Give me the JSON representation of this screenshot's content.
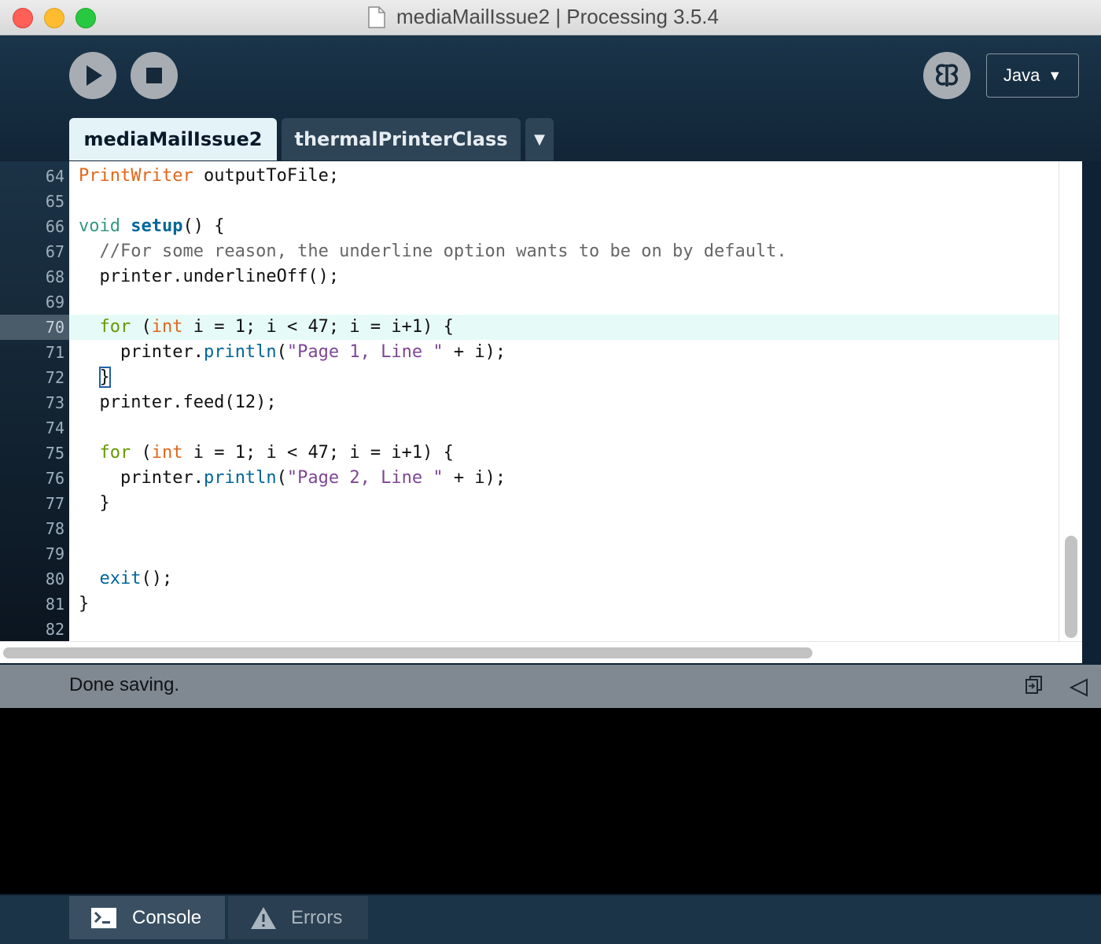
{
  "window": {
    "title": "mediaMailIssue2 | Processing 3.5.4"
  },
  "toolbar": {
    "mode_label": "Java",
    "mode_arrow": "▼"
  },
  "tabs": [
    {
      "label": "mediaMailIssue2",
      "active": true
    },
    {
      "label": "thermalPrinterClass",
      "active": false
    }
  ],
  "tab_menu_glyph": "▼",
  "editor": {
    "current_line": "70",
    "lines": [
      {
        "num": "64"
      },
      {
        "num": "65"
      },
      {
        "num": "66"
      },
      {
        "num": "67"
      },
      {
        "num": "68"
      },
      {
        "num": "69"
      },
      {
        "num": "70"
      },
      {
        "num": "71"
      },
      {
        "num": "72"
      },
      {
        "num": "73"
      },
      {
        "num": "74"
      },
      {
        "num": "75"
      },
      {
        "num": "76"
      },
      {
        "num": "77"
      },
      {
        "num": "78"
      },
      {
        "num": "79"
      },
      {
        "num": "80"
      },
      {
        "num": "81"
      },
      {
        "num": "82"
      }
    ],
    "tokens": {
      "l64_type": "PrintWriter",
      "l64_rest": " outputToFile;",
      "l66_void": "void",
      "l66_sp": " ",
      "l66_setup": "setup",
      "l66_rest": "() {",
      "l67_comment": "  //For some reason, the underline option wants to be on by default.",
      "l68": "  printer.underlineOff();",
      "l70_indent": "  ",
      "l70_for": "for",
      "l70_a": " (",
      "l70_int": "int",
      "l70_b": " i = 1; i < 47; i = i+1) {",
      "l71_a": "    printer.",
      "l71_println": "println",
      "l71_b": "(",
      "l71_str": "\"Page 1, Line \"",
      "l71_c": " + i);",
      "l72_indent": "  ",
      "l72_brace": "}",
      "l73": "  printer.feed(12);",
      "l75_indent": "  ",
      "l75_for": "for",
      "l75_a": " (",
      "l75_int": "int",
      "l75_b": " i = 1; i < 47; i = i+1) {",
      "l76_a": "    printer.",
      "l76_println": "println",
      "l76_b": "(",
      "l76_str": "\"Page 2, Line \"",
      "l76_c": " + i);",
      "l77": "  }",
      "l80_indent": "  ",
      "l80_exit": "exit",
      "l80_rest": "();",
      "l81": "}"
    }
  },
  "status": {
    "message": "Done saving."
  },
  "bottom_tabs": {
    "console_label": "Console",
    "errors_label": "Errors"
  },
  "icons": {
    "run": "play-icon",
    "stop": "stop-icon",
    "debug": "butterfly-icon",
    "copy": "copy-icon",
    "collapse": "triangle-left-icon",
    "console": "terminal-icon",
    "errors": "warning-icon"
  },
  "colors": {
    "background": "#0f2235",
    "keyword_type": "#e2661a",
    "keyword": "#33997e",
    "function": "#006699",
    "control": "#669900",
    "string": "#7d4793",
    "comment": "#666666",
    "current_line_bg": "#e6fbf8"
  }
}
